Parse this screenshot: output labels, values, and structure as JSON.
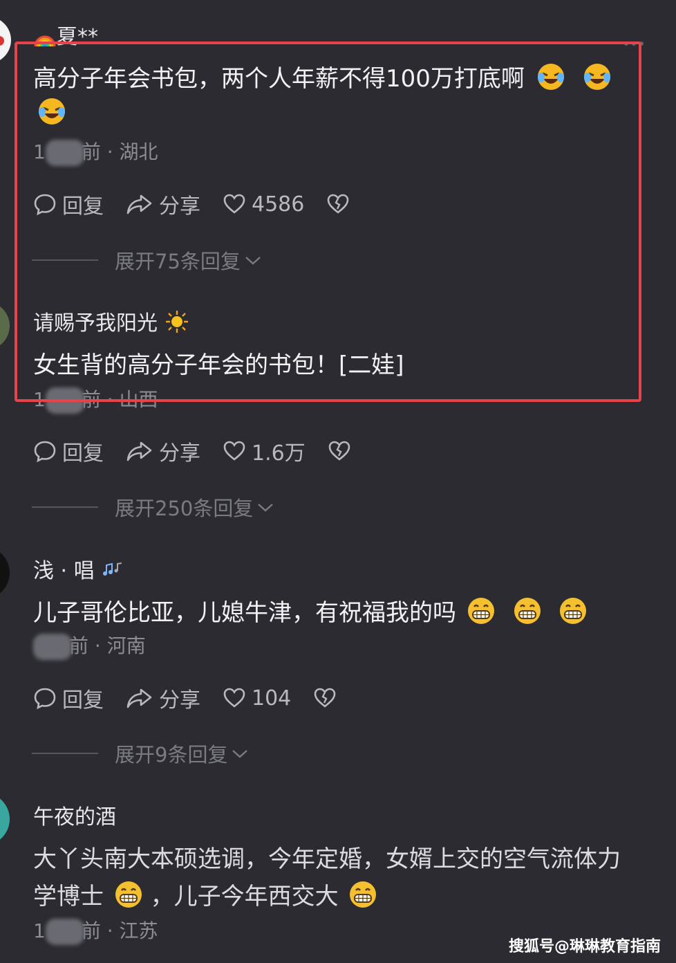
{
  "comments": [
    {
      "user": "夏**",
      "text_line1": "高分子年会书包，两个人年薪不得100万打底啊",
      "meta_prefix": "1",
      "meta_suffix": "前 · 湖北",
      "reply_label": "回复",
      "share_label": "分享",
      "like_count": "4586",
      "expand_label": "展开75条回复"
    },
    {
      "user": "请赐予我阳光",
      "text_line1": "女生背的高分子年会的书包！[二娃]",
      "meta_prefix": "1",
      "meta_suffix": "前 · 山西",
      "reply_label": "回复",
      "share_label": "分享",
      "like_count": "1.6万",
      "expand_label": "展开250条回复"
    },
    {
      "user": "浅 · 唱",
      "text_line1": "儿子哥伦比亚，儿媳牛津，有祝福我的吗",
      "meta_prefix": "",
      "meta_suffix": "前 · 河南",
      "reply_label": "回复",
      "share_label": "分享",
      "like_count": "104",
      "expand_label": "展开9条回复"
    },
    {
      "user": "午夜的酒",
      "text_line1": "大丫头南大本硕选调，今年定婚，女婿上交的空气流体力",
      "text_line2a": "学博士",
      "text_line2b": "，儿子今年西交大",
      "meta_prefix": "1",
      "meta_suffix": "前 · 江苏"
    }
  ],
  "watermark": "搜狐号@琳琳教育指南",
  "colors": {
    "background": "#2b2b31",
    "highlight": "#e8434b",
    "text": "#f2f2f4",
    "meta": "#8d8d94"
  },
  "icons": {
    "reply": "comment-bubble-icon",
    "share": "share-arrow-icon",
    "like": "heart-icon",
    "dislike": "broken-heart-icon",
    "expand": "chevron-down-icon"
  }
}
